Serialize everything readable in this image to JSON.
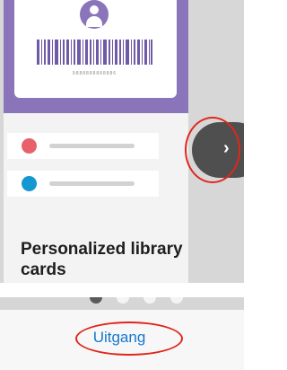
{
  "onboarding": {
    "caption": "Personalized library cards",
    "card": {
      "barcode_number": "9888888888886"
    },
    "list_rows": [
      {
        "dot_color": "#e8616a"
      },
      {
        "dot_color": "#1597d1"
      }
    ],
    "next_button": {
      "icon": "chevron-right-icon",
      "glyph": "›"
    },
    "pagination": {
      "total": 4,
      "active": 1
    }
  },
  "footer": {
    "exit_label": "Uitgang"
  },
  "colors": {
    "card_header": "#8a74ba",
    "highlight": "#e0261c",
    "link": "#1478d0"
  }
}
